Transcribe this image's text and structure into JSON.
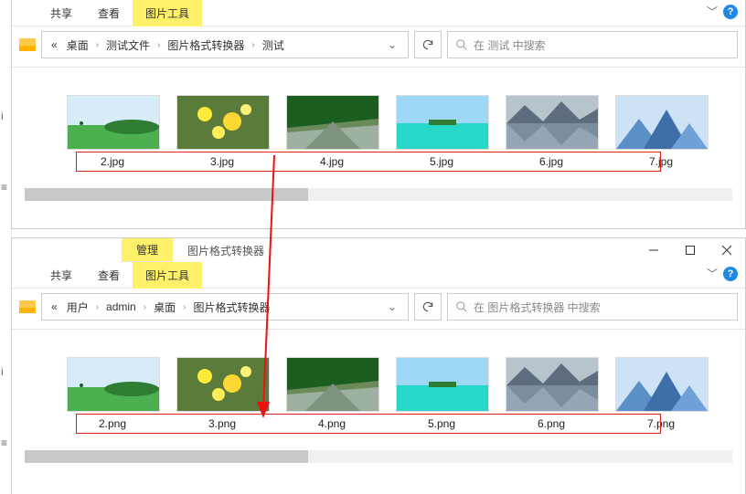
{
  "top_window": {
    "ribbon": {
      "share": "共享",
      "view": "查看",
      "tools": "图片工具"
    },
    "breadcrumbs": [
      "桌面",
      "测试文件",
      "图片格式转换器",
      "测试"
    ],
    "search_placeholder": "在 测试 中搜索",
    "files": [
      "2.jpg",
      "3.jpg",
      "4.jpg",
      "5.jpg",
      "6.jpg",
      "7.jpg"
    ]
  },
  "bottom_window": {
    "ctx_tab": "管理",
    "ctx_title": "图片格式转换器",
    "ribbon": {
      "share": "共享",
      "view": "查看",
      "tools": "图片工具"
    },
    "breadcrumbs": [
      "用户",
      "admin",
      "桌面",
      "图片格式转换器"
    ],
    "search_placeholder": "在 图片格式转换器 中搜索",
    "files": [
      "2.png",
      "3.png",
      "4.png",
      "5.png",
      "6.png",
      "7.png"
    ]
  }
}
